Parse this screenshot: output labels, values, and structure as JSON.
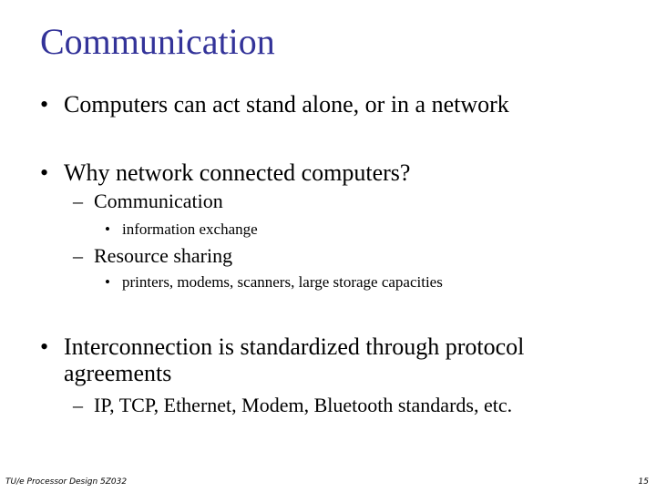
{
  "slide": {
    "title": "Communication",
    "title_color": "#333399",
    "bullets": [
      {
        "marker": "•",
        "text": "Computers can act stand alone, or in a network"
      },
      {
        "marker": "•",
        "text": "Why network connected computers?",
        "sub": [
          {
            "marker": "–",
            "text": "Communication",
            "sub": [
              {
                "marker": "•",
                "text": "information exchange"
              }
            ]
          },
          {
            "marker": "–",
            "text": "Resource sharing",
            "sub": [
              {
                "marker": "•",
                "text": "printers, modems, scanners, large storage capacities"
              }
            ]
          }
        ]
      },
      {
        "marker": "•",
        "text_line1": "Interconnection is standardized through protocol",
        "text_line2": "agreements",
        "sub": [
          {
            "marker": "–",
            "text": "IP, TCP, Ethernet, Modem, Bluetooth standards, etc."
          }
        ]
      }
    ]
  },
  "footer": {
    "left": "TU/e   Processor Design 5Z032",
    "page_number": "15"
  }
}
